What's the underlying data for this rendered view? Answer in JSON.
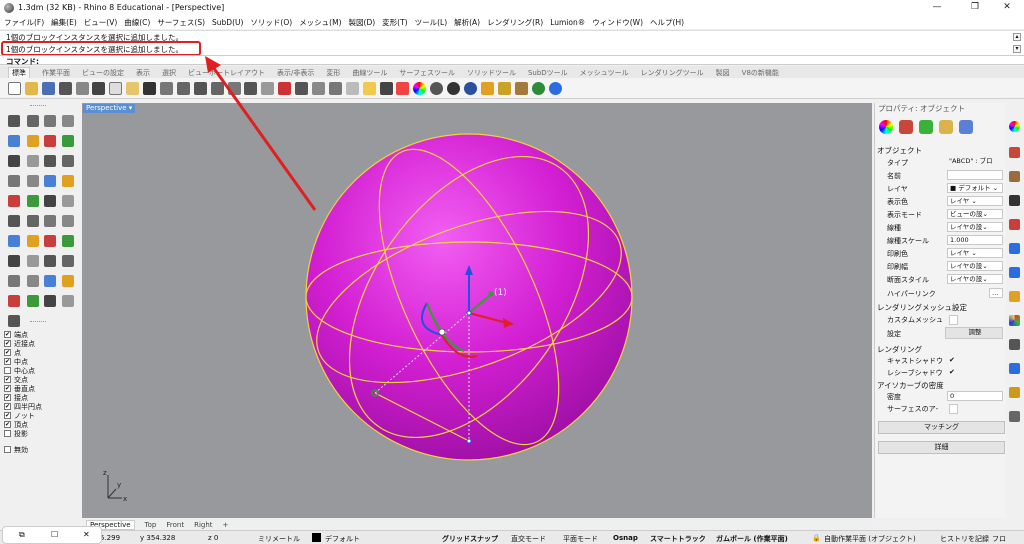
{
  "window": {
    "title": "1.3dm (32 KB) - Rhino 8 Educational - [Perspective]",
    "controls": [
      "—",
      "❐",
      "✕"
    ]
  },
  "menu": [
    "ファイル(F)",
    "編集(E)",
    "ビュー(V)",
    "曲線(C)",
    "サーフェス(S)",
    "SubD(U)",
    "ソリッド(O)",
    "メッシュ(M)",
    "製図(D)",
    "変形(T)",
    "ツール(L)",
    "解析(A)",
    "レンダリング(R)",
    "Lumion®",
    "ウィンドウ(W)",
    "ヘルプ(H)"
  ],
  "command_history": [
    "1個のブロックインスタンスを選択に追加しました。",
    "1個のブロックインスタンスを選択に追加しました。"
  ],
  "command_prompt": "コマンド:",
  "toolbar_tabs": [
    "標準",
    "作業平面",
    "ビューの設定",
    "表示",
    "選択",
    "ビューポートレイアウト",
    "表示/非表示",
    "変形",
    "曲線ツール",
    "サーフェスツール",
    "ソリッドツール",
    "SubDツール",
    "メッシュツール",
    "レンダリングツール",
    "製図",
    "V8の新機能"
  ],
  "viewport": {
    "label": "Perspective",
    "axis_z": "z",
    "axis_y": "y",
    "axis_x": "x"
  },
  "view_tabs": [
    "Perspective",
    "Top",
    "Front",
    "Right"
  ],
  "osnap": {
    "items": [
      {
        "label": "端点",
        "checked": true
      },
      {
        "label": "近接点",
        "checked": true
      },
      {
        "label": "点",
        "checked": true
      },
      {
        "label": "中点",
        "checked": true
      },
      {
        "label": "中心点",
        "checked": false
      },
      {
        "label": "交点",
        "checked": true
      },
      {
        "label": "垂直点",
        "checked": true
      },
      {
        "label": "接点",
        "checked": true
      },
      {
        "label": "四半円点",
        "checked": true
      },
      {
        "label": "ノット",
        "checked": true
      },
      {
        "label": "頂点",
        "checked": true
      },
      {
        "label": "投影",
        "checked": false
      }
    ],
    "disable": {
      "label": "無効",
      "checked": false
    }
  },
  "properties": {
    "panel_title": "プロパティ: オブジェクト",
    "section_object": "オブジェクト",
    "rows": [
      {
        "label": "タイプ",
        "value": "\"ABCD\" : ブロ"
      },
      {
        "label": "名前",
        "value": ""
      },
      {
        "label": "レイヤ",
        "value": "■ デフォルト ⌄"
      },
      {
        "label": "表示色",
        "value": "レイヤ ⌄"
      },
      {
        "label": "表示モード",
        "value": "ビューの設⌄"
      },
      {
        "label": "線種",
        "value": "レイヤの設⌄"
      },
      {
        "label": "線種スケール",
        "value": "1.000"
      },
      {
        "label": "印刷色",
        "value": "レイヤ ⌄"
      },
      {
        "label": "印刷幅",
        "value": "レイヤの設⌄"
      },
      {
        "label": "断面スタイル",
        "value": "レイヤの設⌄"
      }
    ],
    "hyperlink": "ハイパーリンク",
    "render_mesh_section": "レンダリングメッシュ設定",
    "custom_mesh": "カスタムメッシュ",
    "settings_label": "設定",
    "adjust_button": "調整",
    "rendering_section": "レンダリング",
    "cast_shadows": "キャストシャドウ",
    "receive_shadows": "レシーブシャドウ",
    "isocurve_section": "アイソカーブの密度",
    "density_label": "密度",
    "density_value": "0",
    "surface_label": "サーフェスのア-",
    "matching_button": "マッチング",
    "details_button": "詳細"
  },
  "status": {
    "coords_x": "5.299",
    "coords_y": "y 354.328",
    "coords_z": "z 0",
    "units": "ミリメートル",
    "layer": "デフォルト",
    "grid_snap": "グリッドスナップ",
    "ortho": "直交モード",
    "planar": "平面モード",
    "osnap": "Osnap",
    "smarttrack": "スマートトラック",
    "gumball": "ガムボール (作業平面)",
    "auto_cplane": "自動作業平面 (オブジェクト)",
    "history": "ヒストリを記録",
    "filter": "フロ"
  },
  "colors": {
    "sphere": "#d21fd2",
    "viewport_bg": "#98999c",
    "highlight": "#e02020",
    "isocurve": "#f2d23c"
  }
}
